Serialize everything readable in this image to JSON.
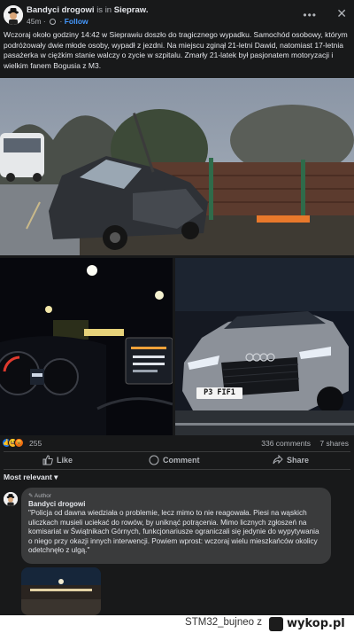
{
  "post": {
    "page_name": "Bandyci drogowi",
    "is_in": "is in",
    "group_name": "Siepraw.",
    "time": "45m",
    "dot": "·",
    "follow": "Follow",
    "text": "Wczoraj około godziny 14:42 w Sieprawiu doszło do tragicznego wypadku. Samochód osobowy, którym podróżowały dwie młode osoby, wypadł z jezdni. Na miejscu zginął 21-letni Dawid, natomiast 17-letnia pasażerka w ciężkim stanie walczy o zycie w szpitalu. Zmarły 21-latek był pasjonatem motoryzacji i wielkim fanem Bogusia z M3."
  },
  "images": {
    "plate_text": "P3 FIF1"
  },
  "reactions": {
    "count": "255",
    "comments": "336 comments",
    "shares": "7 shares"
  },
  "actions": {
    "like": "Like",
    "comment": "Comment",
    "share": "Share"
  },
  "comments": {
    "sort_label": "Most relevant",
    "sort_chevron": "▾",
    "first": {
      "badge": "Author",
      "name": "Bandyci drogowi",
      "text": "\"Policja od dawna wiedziała o problemie, lecz mimo to nie reagowała. Piesi na wąskich uliczkach musieli uciekać do rowów, by uniknąć potrącenia. Mimo licznych zgłoszeń na komisariat w Świątnikach Górnych, funkcjonariusze ograniczali się jedynie do wypytywania o niego przy okazji innych interwencji. Powiem wprost: wczoraj wielu mieszkańców okolicy odetchnęło z ulgą.\""
    }
  },
  "watermark": {
    "user": "STM32_bujneo",
    "separator": "z",
    "brand": "wykop.pl"
  },
  "colors": {
    "background": "#18191a",
    "link": "#4599ff",
    "comment_bubble": "#3a3b3c"
  }
}
